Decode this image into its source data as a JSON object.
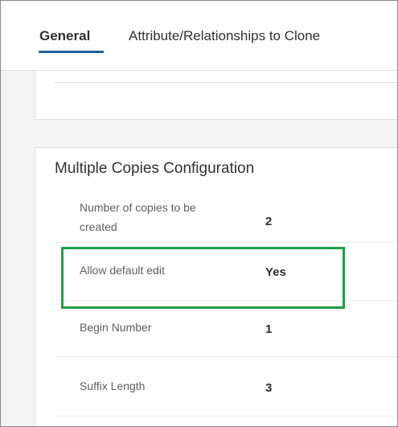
{
  "tabs": {
    "general": "General",
    "attributes": "Attribute/Relationships to Clone"
  },
  "section": {
    "title": "Multiple Copies Configuration",
    "fields": [
      {
        "label": "Number of copies to be created",
        "value": "2"
      },
      {
        "label": "Allow default edit",
        "value": "Yes"
      },
      {
        "label": "Begin Number",
        "value": "1"
      },
      {
        "label": "Suffix Length",
        "value": "3"
      }
    ]
  },
  "colors": {
    "tab_underline": "#1f5fa8",
    "highlight_box": "#1e9e48"
  }
}
